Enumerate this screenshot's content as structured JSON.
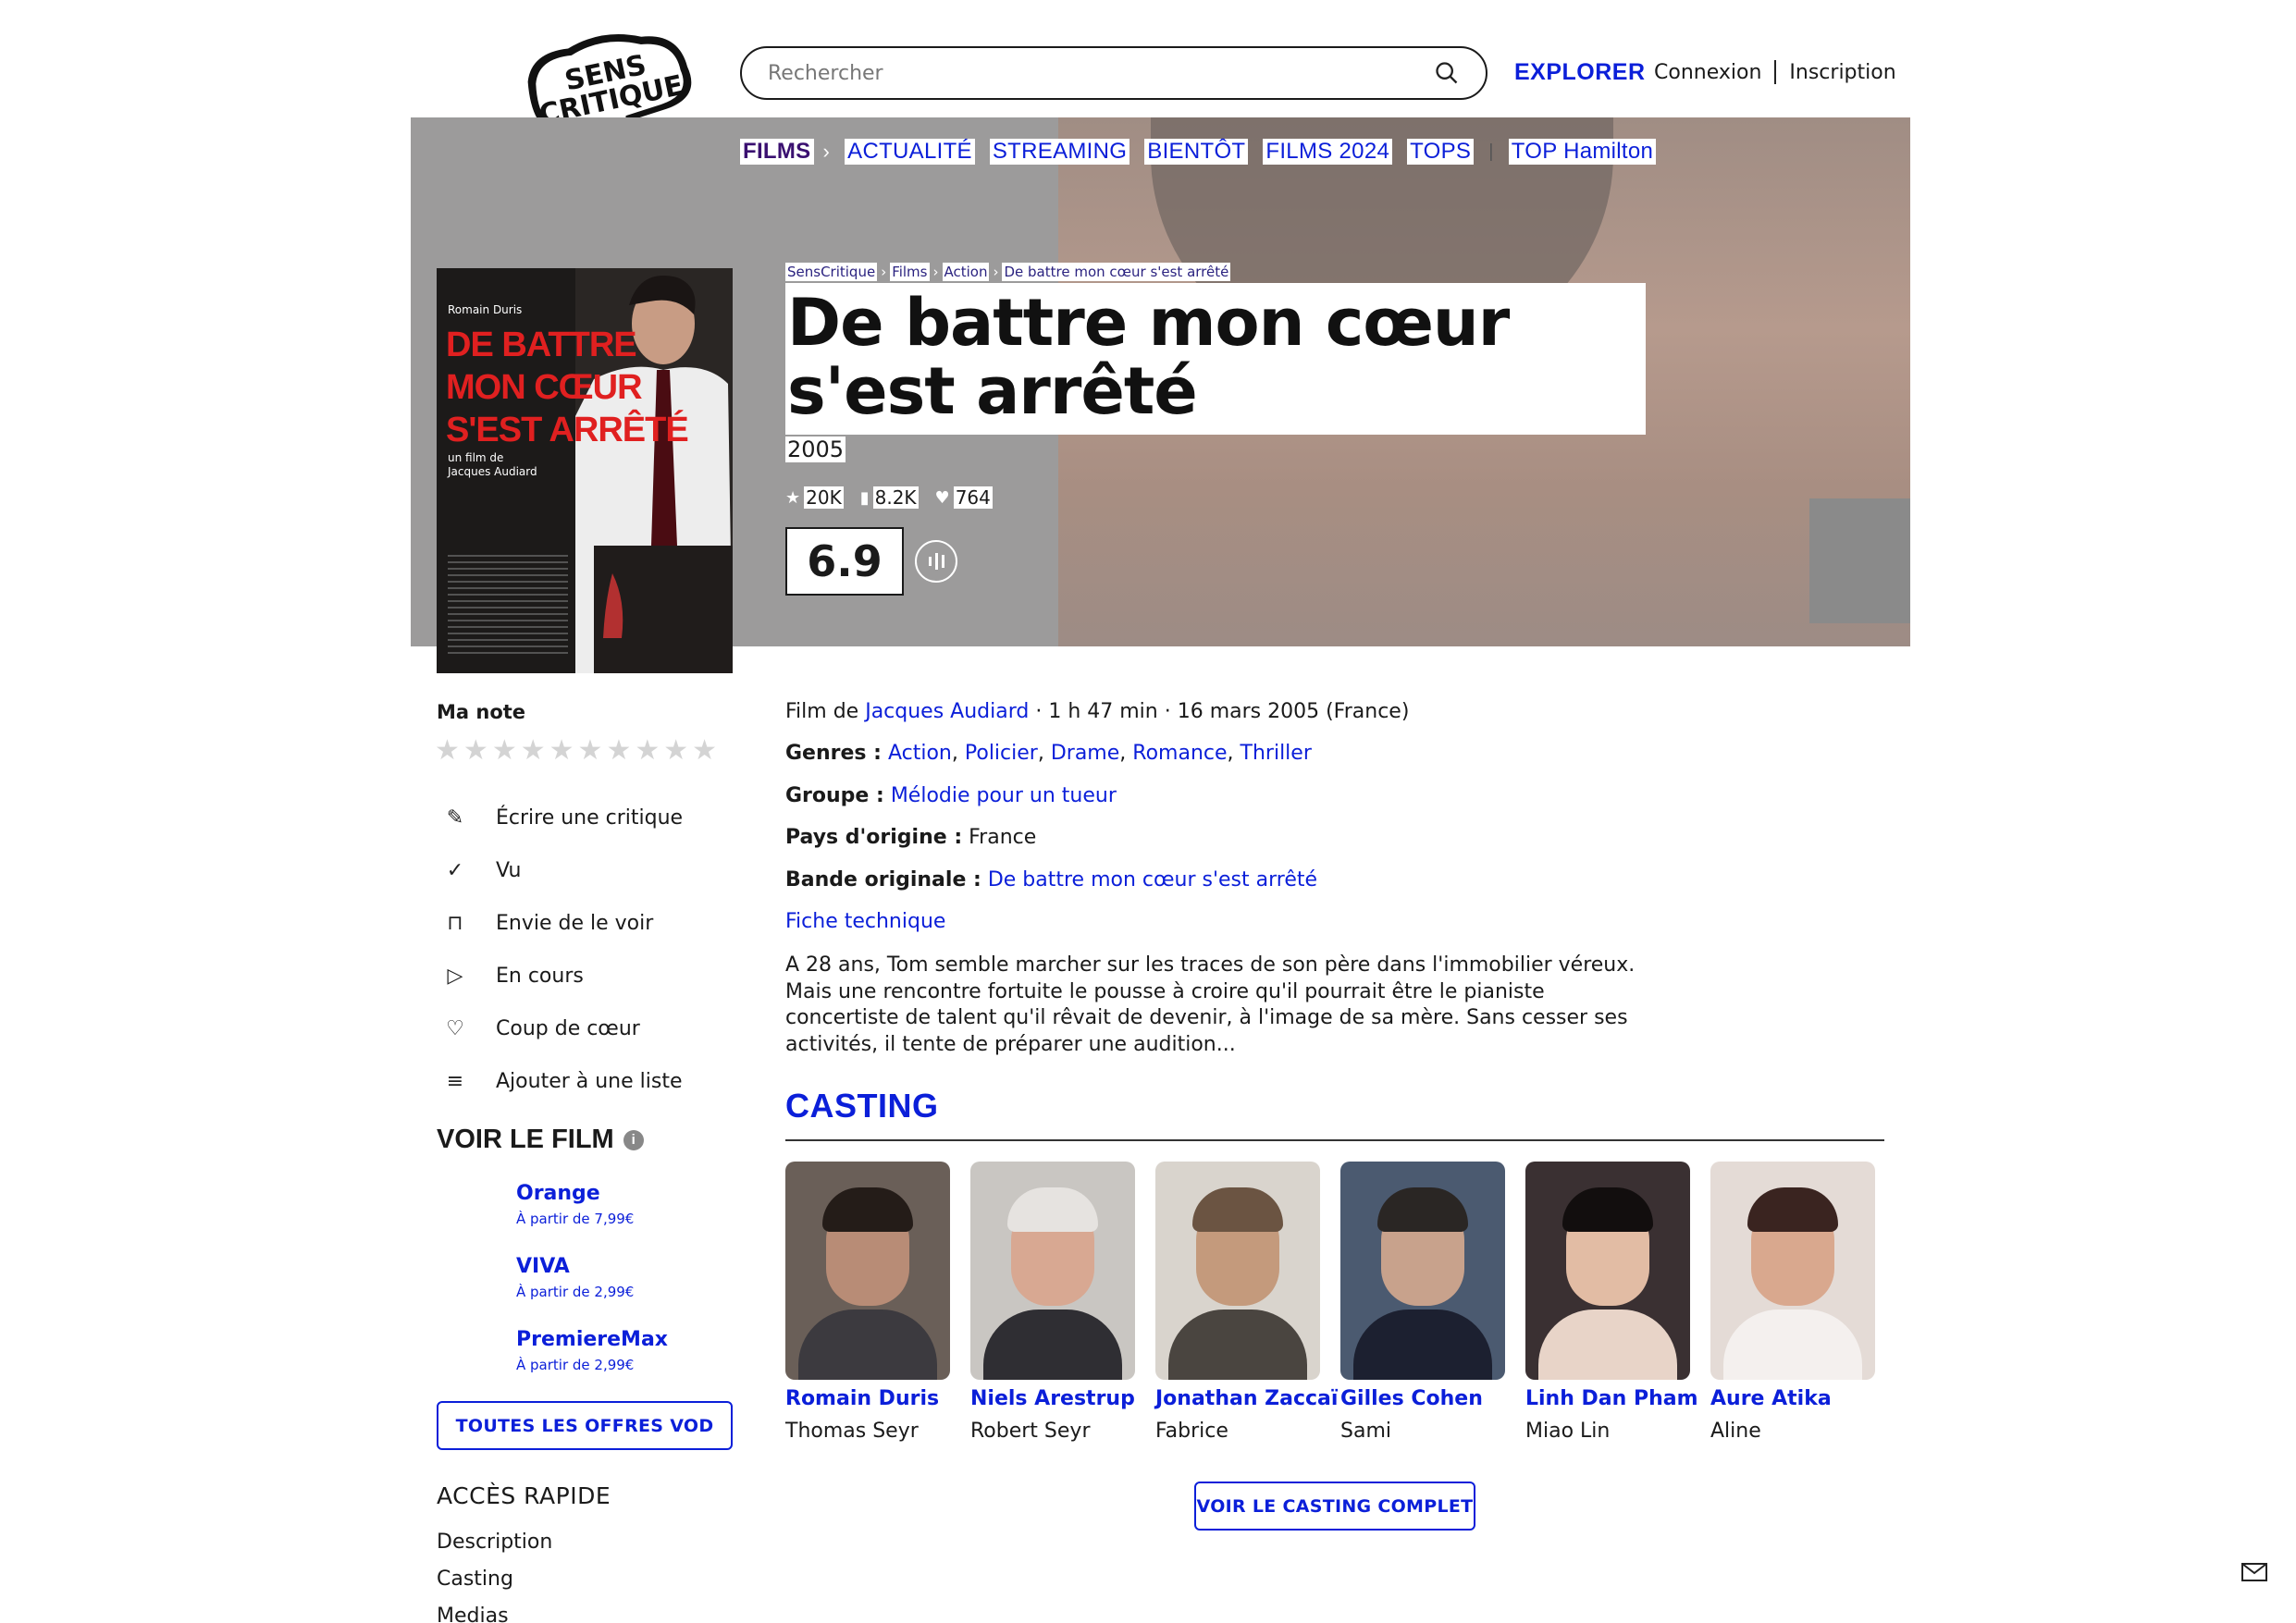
{
  "header": {
    "logo_text": "SENS CRITIQUE",
    "search_placeholder": "Rechercher",
    "explorer_label": "EXPLORER",
    "login_label": "Connexion",
    "signup_label": "Inscription"
  },
  "nav": {
    "items": [
      "FILMS",
      "ACTUALITÉ",
      "STREAMING",
      "BIENTÔT",
      "FILMS 2024",
      "TOPS",
      "TOP Hamilton"
    ]
  },
  "breadcrumb": [
    "SensCritique",
    "Films",
    "Action",
    "De battre mon cœur s'est arrêté"
  ],
  "film": {
    "title": "De battre mon cœur s'est arrêté",
    "year": "2005",
    "ratings_count": "20K",
    "wishlist_count": "8.2K",
    "favorites_count": "764",
    "score": "6.9",
    "poster": {
      "actor": "Romain Duris",
      "title_lines": [
        "DE BATTRE",
        "MON CŒUR",
        "S'EST ARRÊTÉ"
      ],
      "subtitle_lines": [
        "un film de",
        "Jacques Audiard"
      ]
    }
  },
  "sidebar": {
    "my_rating_label": "Ma note",
    "stars_count": 10,
    "actions": [
      {
        "icon": "pencil-icon",
        "glyph": "✎",
        "label": "Écrire une critique"
      },
      {
        "icon": "check-icon",
        "glyph": "✓",
        "label": "Vu"
      },
      {
        "icon": "bookmark-icon",
        "glyph": "⊓",
        "label": "Envie de le voir"
      },
      {
        "icon": "play-icon",
        "glyph": "▷",
        "label": "En cours"
      },
      {
        "icon": "heart-icon",
        "glyph": "♡",
        "label": "Coup de cœur"
      },
      {
        "icon": "add-list-icon",
        "glyph": "≡",
        "label": "Ajouter à une liste"
      }
    ],
    "watch_title": "VOIR LE FILM",
    "offers": [
      {
        "name": "Orange",
        "price": "À partir de 7,99€"
      },
      {
        "name": "VIVA",
        "price": "À partir de 2,99€"
      },
      {
        "name": "PremiereMax",
        "price": "À partir de 2,99€"
      }
    ],
    "all_offers_label": "TOUTES LES OFFRES VOD",
    "quick_access_title": "ACCÈS RAPIDE",
    "quick_links": [
      "Description",
      "Casting",
      "Medias"
    ]
  },
  "details": {
    "film_by_label": "Film de",
    "director": "Jacques Audiard",
    "meta": " · 1 h 47 min · 16 mars 2005 (France)",
    "genres_label": "Genres :",
    "genres": [
      "Action",
      "Policier",
      "Drame",
      "Romance",
      "Thriller"
    ],
    "group_label": "Groupe :",
    "group": "Mélodie pour un tueur",
    "country_label": "Pays d'origine :",
    "country": "France",
    "soundtrack_label": "Bande originale :",
    "soundtrack": "De battre mon cœur s'est arrêté",
    "tech_sheet": "Fiche technique",
    "synopsis": "A 28 ans, Tom semble marcher sur les traces de son père dans l'immobilier véreux. Mais une rencontre fortuite le pousse à croire qu'il pourrait être le pianiste concertiste de talent qu'il rêvait de devenir, à l'image de sa mère. Sans cesser ses activités, il tente de préparer une audition..."
  },
  "casting": {
    "title": "CASTING",
    "actors": [
      {
        "name": "Romain Duris",
        "role": "Thomas Seyr"
      },
      {
        "name": "Niels Arestrup",
        "role": "Robert Seyr"
      },
      {
        "name": "Jonathan Zaccaï",
        "role": "Fabrice"
      },
      {
        "name": "Gilles Cohen",
        "role": "Sami"
      },
      {
        "name": "Linh Dan Pham",
        "role": "Miao Lin"
      },
      {
        "name": "Aure Atika",
        "role": "Aline"
      }
    ],
    "full_cast_label": "VOIR LE CASTING COMPLET"
  },
  "colors": {
    "accent": "#0b1fd9",
    "nav_active": "#3a1070",
    "banner_bg": "#9c9b9b"
  }
}
